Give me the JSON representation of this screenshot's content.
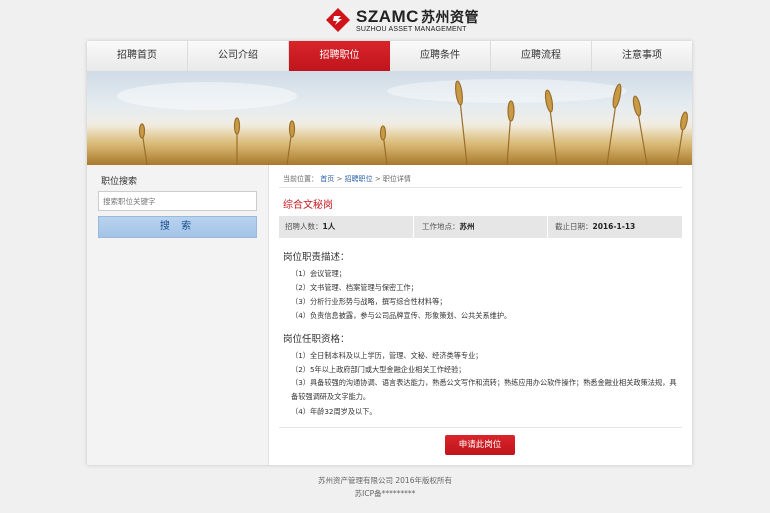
{
  "logo": {
    "brand": "SZAMC",
    "brand_cn": "苏州资管",
    "subtitle": "SUZHOU ASSET MANAGEMENT"
  },
  "nav": {
    "items": [
      {
        "label": "招聘首页"
      },
      {
        "label": "公司介绍"
      },
      {
        "label": "招聘职位"
      },
      {
        "label": "应聘条件"
      },
      {
        "label": "应聘流程"
      },
      {
        "label": "注意事项"
      }
    ],
    "active_index": 2
  },
  "sidebar": {
    "title": "职位搜索",
    "search_placeholder": "搜索职位关键字",
    "search_button": "搜 索"
  },
  "breadcrumb": {
    "prefix": "当前位置：",
    "home": "首页",
    "sep": ">",
    "list": "招聘职位",
    "current": "职位详情"
  },
  "job": {
    "title": "综合文秘岗",
    "headcount_label": "招聘人数：",
    "headcount": "1人",
    "location_label": "工作地点：",
    "location": "苏州",
    "deadline_label": "截止日期：",
    "deadline": "2016-1-13"
  },
  "duties": {
    "heading": "岗位职责描述：",
    "items": [
      "（1）会议管理；",
      "（2）文书管理、档案管理与保密工作；",
      "（3）分析行业形势与战略，撰写综合性材料等；",
      "（4）负责信息披露，参与公司品牌宣传、形象策划、公共关系维护。"
    ]
  },
  "requirements": {
    "heading": "岗位任职资格：",
    "items": [
      "（1）全日制本科及以上学历，管理、文秘、经济类等专业；",
      "（2）5年以上政府部门或大型金融企业相关工作经验；",
      "（3）具备较强的沟通协调、语言表达能力，熟悉公文写作和流转；熟练应用办公软件操作；熟悉金融业相关政策法规，具备较强调研及文字能力。",
      "（4）年龄32周岁及以下。"
    ]
  },
  "apply_button": "申请此岗位",
  "footer": {
    "copyright": "苏州资产管理有限公司 2016年版权所有",
    "icp": "苏ICP备*********"
  },
  "colors": {
    "accent": "#c8161d",
    "search_button": "#a9c7e8",
    "link": "#2b5ea8"
  }
}
